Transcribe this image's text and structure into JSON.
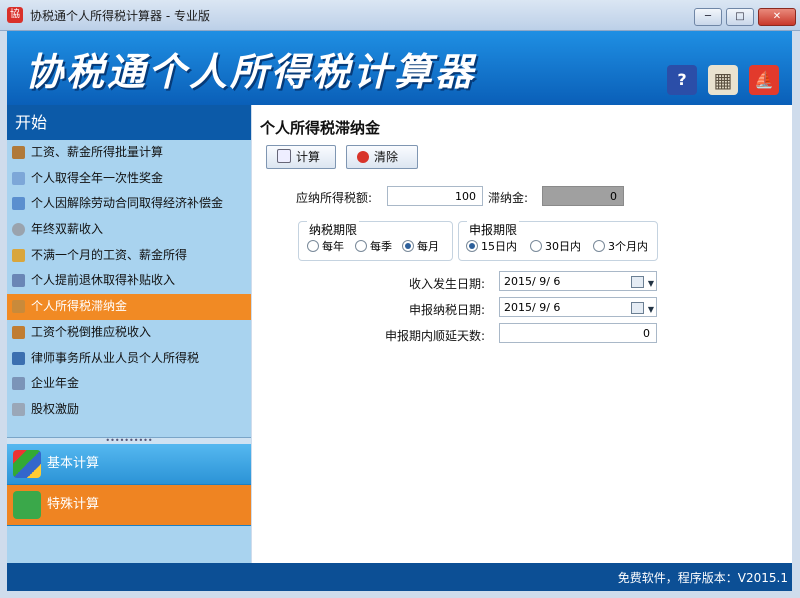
{
  "window": {
    "title": "协税通个人所得税计算器 - 专业版",
    "controls": {
      "minimize": "─",
      "maximize": "□",
      "close": "✕"
    }
  },
  "banner": {
    "title": "协税通个人所得税计算器",
    "buttons": [
      {
        "name": "help",
        "label": "?"
      },
      {
        "name": "calculator",
        "label": "▦"
      },
      {
        "name": "exit",
        "label": "⛵"
      }
    ]
  },
  "sidebar": {
    "header": "开始",
    "items": [
      {
        "label": "工资、薪金所得批量计算",
        "icon": "batch-icon",
        "color": "#b07a3a"
      },
      {
        "label": "个人取得全年一次性奖金",
        "icon": "document-icon",
        "color": "#7da7d8"
      },
      {
        "label": "个人因解除劳动合同取得经济补偿金",
        "icon": "edit-icon",
        "color": "#5b8fcf"
      },
      {
        "label": "年终双薪收入",
        "icon": "gear-icon",
        "color": "#9aa3ad"
      },
      {
        "label": "不满一个月的工资、薪金所得",
        "icon": "money-icon",
        "color": "#d9a63c"
      },
      {
        "label": "个人提前退休取得补贴收入",
        "icon": "book-icon",
        "color": "#6a86b6"
      },
      {
        "label": "个人所得税滞纳金",
        "icon": "coins-icon",
        "color": "#c98a3a",
        "active": true
      },
      {
        "label": "工资个税倒推应税收入",
        "icon": "calculator-icon",
        "color": "#c07d32"
      },
      {
        "label": "律师事务所从业人员个人所得税",
        "icon": "lawyer-icon",
        "color": "#3b6fb0"
      },
      {
        "label": "企业年金",
        "icon": "table-icon",
        "color": "#7b94b8"
      },
      {
        "label": "股权激励",
        "icon": "chart-icon",
        "color": "#9aa7b8"
      }
    ],
    "splitter": "••••••••••",
    "nav": [
      {
        "label": "基本计算",
        "icon": "puzzle-icon"
      },
      {
        "label": "特殊计算",
        "icon": "list-icon"
      }
    ]
  },
  "main": {
    "title": "个人所得税滞纳金",
    "buttons": {
      "calc": "计算",
      "clear": "清除"
    },
    "form": {
      "tax_label": "应纳所得税额:",
      "tax_value": "100",
      "late_label": "滞纳金:",
      "late_value": "0",
      "period_group": {
        "title": "纳税期限",
        "options": [
          "每年",
          "每季",
          "每月"
        ],
        "selected": 2
      },
      "report_group": {
        "title": "申报期限",
        "options": [
          "15日内",
          "30日内",
          "3个月内"
        ],
        "selected": 0
      },
      "income_date_label": "收入发生日期:",
      "income_date": "2015/ 9/ 6",
      "report_date_label": "申报纳税日期:",
      "report_date": "2015/ 9/ 6",
      "delay_label": "申报期内顺延天数:",
      "delay_value": "0"
    }
  },
  "status": {
    "text": "免费软件，程序版本：V2015.1"
  },
  "colors": {
    "banner": "#0a5fb8",
    "active": "#f18a24",
    "sidebar": "#a9d3ef",
    "statusbar": "#0c4f95"
  }
}
